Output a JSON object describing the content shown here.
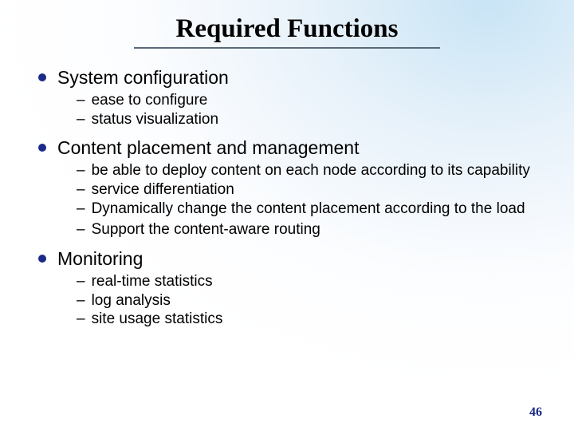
{
  "title": "Required Functions",
  "slide_number": "46",
  "sections": [
    {
      "heading": "System configuration",
      "items": [
        "ease to configure",
        "status visualization"
      ]
    },
    {
      "heading": "Content placement and management",
      "items": [
        "be able to deploy content on each node according to its capability",
        "service differentiation",
        "Dynamically change the content placement according to the load",
        "Support the content-aware routing"
      ]
    },
    {
      "heading": "Monitoring",
      "items": [
        "real-time statistics",
        "log analysis",
        "site usage statistics"
      ]
    }
  ]
}
